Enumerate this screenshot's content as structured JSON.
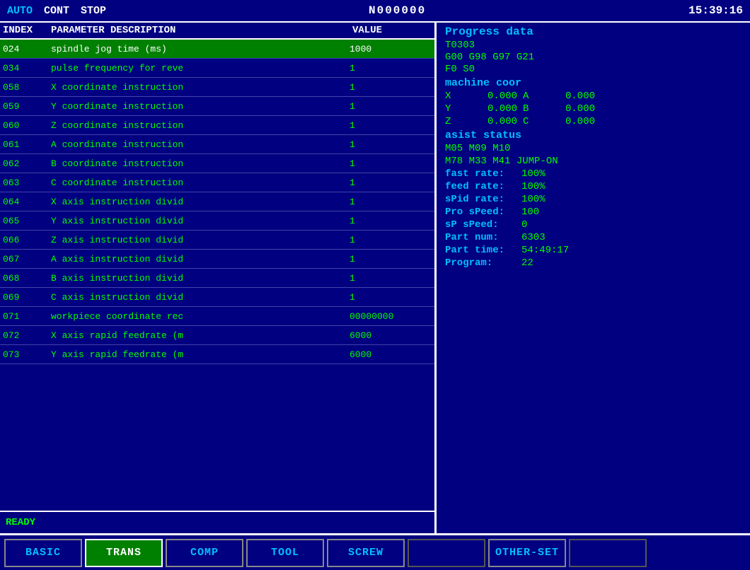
{
  "topbar": {
    "mode": "AUTO",
    "status1": "CONT",
    "status2": "STOP",
    "program_num": "N000000",
    "time": "15:39:16"
  },
  "table": {
    "headers": {
      "index": "INDEX",
      "desc": "PARAMETER DESCRIPTION",
      "value": "VALUE"
    },
    "rows": [
      {
        "index": "024",
        "desc": "spindle jog time (ms)",
        "value": "1000",
        "selected": true
      },
      {
        "index": "034",
        "desc": "pulse frequency for reve",
        "value": "1",
        "selected": false
      },
      {
        "index": "058",
        "desc": "X coordinate instruction",
        "value": "1",
        "selected": false
      },
      {
        "index": "059",
        "desc": "Y coordinate instruction",
        "value": "1",
        "selected": false
      },
      {
        "index": "060",
        "desc": "Z coordinate instruction",
        "value": "1",
        "selected": false
      },
      {
        "index": "061",
        "desc": "A coordinate instruction",
        "value": "1",
        "selected": false
      },
      {
        "index": "062",
        "desc": "B coordinate instruction",
        "value": "1",
        "selected": false
      },
      {
        "index": "063",
        "desc": "C coordinate instruction",
        "value": "1",
        "selected": false
      },
      {
        "index": "064",
        "desc": "X axis instruction divid",
        "value": "1",
        "selected": false
      },
      {
        "index": "065",
        "desc": "Y axis instruction divid",
        "value": "1",
        "selected": false
      },
      {
        "index": "066",
        "desc": "Z axis instruction divid",
        "value": "1",
        "selected": false
      },
      {
        "index": "067",
        "desc": "A axis instruction divid",
        "value": "1",
        "selected": false
      },
      {
        "index": "068",
        "desc": "B axis instruction divid",
        "value": "1",
        "selected": false
      },
      {
        "index": "069",
        "desc": "C axis instruction divid",
        "value": "1",
        "selected": false
      },
      {
        "index": "071",
        "desc": "workpiece coordinate rec",
        "value": "00000000",
        "selected": false
      },
      {
        "index": "072",
        "desc": "X axis rapid feedrate (m",
        "value": "6000",
        "selected": false
      },
      {
        "index": "073",
        "desc": "Y axis rapid feedrate (m",
        "value": "6000",
        "selected": false
      }
    ]
  },
  "status_bar": {
    "text": "READY"
  },
  "right_panel": {
    "progress_title": "Progress data",
    "tool": "T0303",
    "gcodes": "G00  G98  G97  G21",
    "fso": "F0       S0",
    "machine_coor_title": "machine coor",
    "coords": [
      {
        "axis": "X",
        "value": "0.000",
        "axis2": "A",
        "value2": "0.000"
      },
      {
        "axis": "Y",
        "value": "0.000",
        "axis2": "B",
        "value2": "0.000"
      },
      {
        "axis": "Z",
        "value": "0.000",
        "axis2": "C",
        "value2": "0.000"
      }
    ],
    "asist_title": "asist status",
    "m_codes_row1": "M05     M09     M10",
    "m_codes_row2": "M78     M33     M41 JUMP-ON",
    "fast_rate_label": "fast rate:",
    "fast_rate_val": "100%",
    "feed_rate_label": "feed rate:",
    "feed_rate_val": "100%",
    "spid_rate_label": "sPid rate:",
    "spid_rate_val": "100%",
    "pro_speed_label": "Pro sPeed:",
    "pro_speed_val": "100",
    "sp_speed_label": "sP  sPeed:",
    "sp_speed_val": "0",
    "part_num_label": "Part    num:",
    "part_num_val": "6303",
    "part_time_label": "Part time:",
    "part_time_val": "54:49:17",
    "program_label": "Program:",
    "program_val": "22"
  },
  "tabs": [
    {
      "label": "BASIC",
      "active": false
    },
    {
      "label": "TRANS",
      "active": true
    },
    {
      "label": "COMP",
      "active": false
    },
    {
      "label": "TOOL",
      "active": false
    },
    {
      "label": "SCREW",
      "active": false
    },
    {
      "label": "",
      "active": false
    },
    {
      "label": "OTHER-SET",
      "active": false
    },
    {
      "label": "",
      "active": false
    }
  ]
}
